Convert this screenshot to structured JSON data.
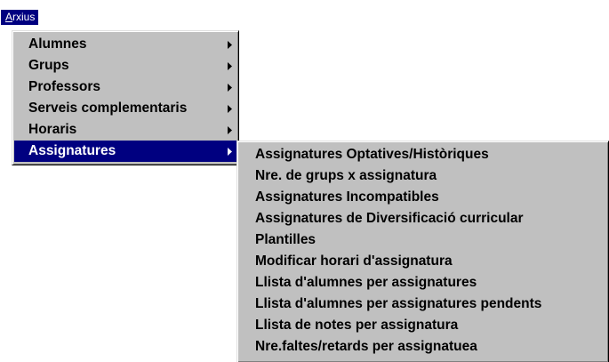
{
  "menubar": {
    "arxius_mnemonic": "A",
    "arxius_rest": "rxius"
  },
  "main_menu": {
    "items": [
      {
        "label": "Alumnes",
        "has_submenu": true
      },
      {
        "label": "Grups",
        "has_submenu": true
      },
      {
        "label": "Professors",
        "has_submenu": true
      },
      {
        "label": "Serveis complementaris",
        "has_submenu": true
      },
      {
        "label": "Horaris",
        "has_submenu": true
      },
      {
        "label": "Assignatures",
        "has_submenu": true,
        "selected": true
      }
    ]
  },
  "submenu": {
    "items": [
      {
        "label": "Assignatures Optatives/Històriques"
      },
      {
        "label": "Nre. de grups x assignatura"
      },
      {
        "label": "Assignatures Incompatibles"
      },
      {
        "label": "Assignatures de Diversificació curricular"
      },
      {
        "label": "Plantilles"
      },
      {
        "label": "Modificar horari d'assignatura"
      },
      {
        "label": "Llista d'alumnes per assignatures"
      },
      {
        "label": "Llista d'alumnes per assignatures pendents"
      },
      {
        "label": "Llista de notes per assignatura"
      },
      {
        "label": "Nre.faltes/retards per assignatuea"
      }
    ]
  },
  "colors": {
    "menu_bg": "#c0c0c0",
    "highlight": "#000080",
    "highlight_text": "#ffffff"
  },
  "icons": {
    "submenu_arrow": "triangle-right-icon"
  }
}
